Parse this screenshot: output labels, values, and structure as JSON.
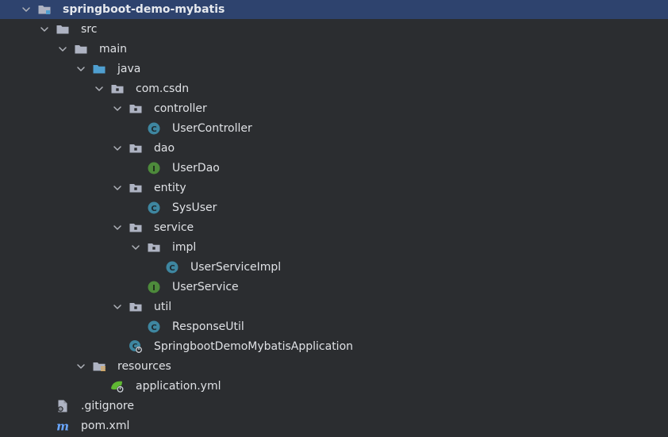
{
  "project_tree": {
    "nodes": [
      {
        "id": "root",
        "label": "springboot-demo-mybatis",
        "icon": "module-folder-icon",
        "expanded": true,
        "selected": true
      },
      {
        "id": "src",
        "label": "src",
        "icon": "folder-icon",
        "expanded": true
      },
      {
        "id": "main",
        "label": "main",
        "icon": "folder-icon",
        "expanded": true
      },
      {
        "id": "java",
        "label": "java",
        "icon": "source-root-icon",
        "expanded": true
      },
      {
        "id": "com_csdn",
        "label": "com.csdn",
        "icon": "package-icon",
        "expanded": true
      },
      {
        "id": "controller",
        "label": "controller",
        "icon": "package-icon",
        "expanded": true
      },
      {
        "id": "UserController",
        "label": "UserController",
        "icon": "class-icon"
      },
      {
        "id": "dao",
        "label": "dao",
        "icon": "package-icon",
        "expanded": true
      },
      {
        "id": "UserDao",
        "label": "UserDao",
        "icon": "interface-icon"
      },
      {
        "id": "entity",
        "label": "entity",
        "icon": "package-icon",
        "expanded": true
      },
      {
        "id": "SysUser",
        "label": "SysUser",
        "icon": "class-icon"
      },
      {
        "id": "service",
        "label": "service",
        "icon": "package-icon",
        "expanded": true
      },
      {
        "id": "impl",
        "label": "impl",
        "icon": "package-icon",
        "expanded": true
      },
      {
        "id": "UserServiceImpl",
        "label": "UserServiceImpl",
        "icon": "class-icon"
      },
      {
        "id": "UserService",
        "label": "UserService",
        "icon": "interface-icon"
      },
      {
        "id": "util",
        "label": "util",
        "icon": "package-icon",
        "expanded": true
      },
      {
        "id": "ResponseUtil",
        "label": "ResponseUtil",
        "icon": "class-icon"
      },
      {
        "id": "SpringbootDemoMybatisApplication",
        "label": "SpringbootDemoMybatisApplication",
        "icon": "spring-boot-class-icon"
      },
      {
        "id": "resources",
        "label": "resources",
        "icon": "resources-folder-icon",
        "expanded": true
      },
      {
        "id": "application_yml",
        "label": "application.yml",
        "icon": "spring-config-icon"
      },
      {
        "id": "gitignore",
        "label": ".gitignore",
        "icon": "gitignore-file-icon"
      },
      {
        "id": "pom_xml",
        "label": "pom.xml",
        "icon": "maven-pom-icon"
      }
    ]
  },
  "colors": {
    "background": "#2b2d30",
    "selection": "#2e436e",
    "text": "#dfe1e5",
    "folder": "#aeb3c2",
    "source_root": "#4f9fd0",
    "class_icon": "#3e86a0",
    "interface_icon": "#4d8a3b",
    "spring_green": "#5fb832",
    "maven_blue": "#6aa7ff"
  }
}
